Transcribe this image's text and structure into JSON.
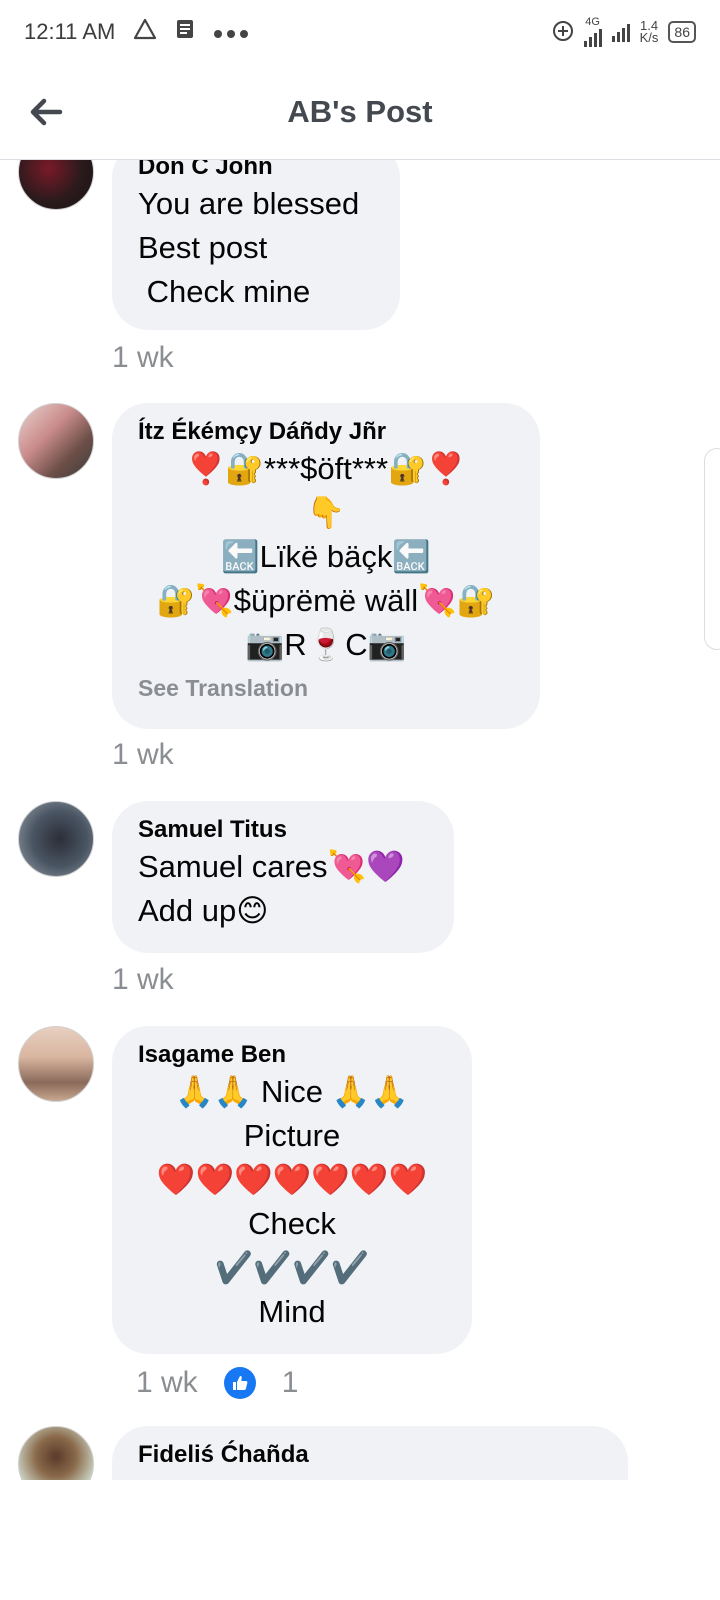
{
  "status_bar": {
    "time": "12:11 AM",
    "network_type": "4G",
    "net_speed_value": "1.4",
    "net_speed_unit": "K/s",
    "battery": "86"
  },
  "header": {
    "title": "AB's Post"
  },
  "comments": [
    {
      "author": "Don C John",
      "lines": [
        "You are blessed",
        "Best post",
        " Check mine"
      ],
      "time": "1 wk"
    },
    {
      "author": "Ítz Ékémçy Dáñdy Jñr",
      "lines": [
        "❣️🔐***$öft***🔐❣️",
        "👇",
        "🔙Lïkë bäçk🔙",
        "🔐💘$üprëmë wäll💘🔐",
        "📷R🍷C📷"
      ],
      "see_translation": "See Translation",
      "time": "1 wk"
    },
    {
      "author": "Samuel Titus",
      "lines": [
        "Samuel cares💘💜",
        "Add up😊"
      ],
      "time": "1 wk"
    },
    {
      "author": "Isagame Ben",
      "lines": [
        "🙏🙏 Nice 🙏🙏",
        "Picture",
        "❤️❤️❤️❤️❤️❤️❤️",
        "Check",
        "✔️✔️✔️✔️",
        "Mind"
      ],
      "time": "1 wk",
      "like_count": "1"
    },
    {
      "author": "Fideliś Ćhañda"
    }
  ],
  "colors": {
    "bubble": "#f0f2f5",
    "meta_text": "#8a8d91",
    "like_blue": "#1877f2",
    "title_text": "#444950"
  }
}
